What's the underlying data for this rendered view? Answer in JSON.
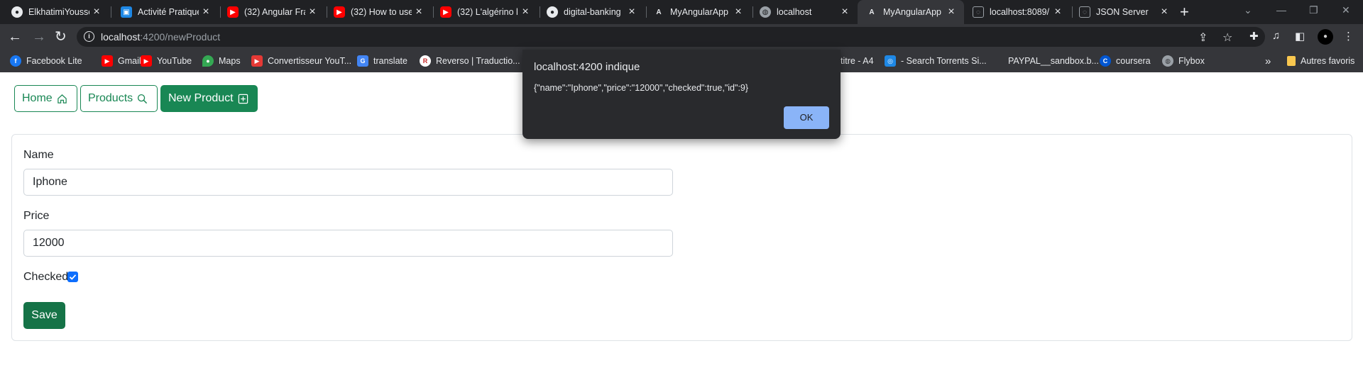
{
  "browser": {
    "tabs": [
      {
        "title": "ElkhatimiYoussef",
        "icon": "github-icon"
      },
      {
        "title": "Activité Pratique",
        "icon": "classroom-icon"
      },
      {
        "title": "(32) Angular Fra",
        "icon": "youtube-icon"
      },
      {
        "title": "(32) How to use",
        "icon": "youtube-icon"
      },
      {
        "title": "(32) L'algérino li",
        "icon": "youtube-icon"
      },
      {
        "title": "digital-banking",
        "icon": "github-icon"
      },
      {
        "title": "MyAngularApp",
        "icon": "angular-icon"
      },
      {
        "title": "localhost",
        "icon": "globe-icon"
      },
      {
        "title": "MyAngularApp",
        "icon": "angular-icon"
      },
      {
        "title": "localhost:8089/",
        "icon": "page-icon"
      },
      {
        "title": "JSON Server",
        "icon": "page-icon"
      }
    ],
    "active_tab_index": 8,
    "url_host": "localhost",
    "url_rest": ":4200/newProduct",
    "bookmarks": [
      {
        "label": "Facebook Lite",
        "icon": "facebook-icon",
        "color": "#1877f2"
      },
      {
        "label": "Gmail",
        "icon": "youtube-icon",
        "color": "#ff0000"
      },
      {
        "label": "YouTube",
        "icon": "youtube-icon",
        "color": "#ff0000"
      },
      {
        "label": "Maps",
        "icon": "maps-icon",
        "color": "#34a853"
      },
      {
        "label": "Convertisseur YouT...",
        "icon": "play-icon",
        "color": "#e53935"
      },
      {
        "label": "translate",
        "icon": "translate-icon",
        "color": "#4285f4"
      },
      {
        "label": "Reverso | Traductio...",
        "icon": "reverso-icon",
        "color": "#ffffff"
      },
      {
        "label": "titre - A4",
        "icon": "none",
        "color": "#35363a"
      },
      {
        "label": "- Search Torrents Si...",
        "icon": "search-icon",
        "color": "#1e88e5"
      },
      {
        "label": "PAYPAL__sandbox.b...",
        "icon": "none",
        "color": "#35363a"
      },
      {
        "label": "coursera",
        "icon": "coursera-icon",
        "color": "#0056d2"
      },
      {
        "label": "Flybox",
        "icon": "globe-icon",
        "color": "#9aa0a6"
      }
    ],
    "more_bookmarks": "»",
    "other_bookmarks": "Autres favoris"
  },
  "nav": {
    "home": "Home",
    "products": "Products",
    "new_product": "New Product"
  },
  "form": {
    "name_label": "Name",
    "name_value": "Iphone",
    "price_label": "Price",
    "price_value": "12000",
    "checked_label": "Checked",
    "checked": true,
    "save_label": "Save"
  },
  "dialog": {
    "title": "localhost:4200 indique",
    "message": "{\"name\":\"Iphone\",\"price\":\"12000\",\"checked\":true,\"id\":9}",
    "ok_label": "OK"
  },
  "colors": {
    "success": "#198754",
    "primary": "#0d6efd",
    "dialog_button": "#8ab4f8"
  }
}
